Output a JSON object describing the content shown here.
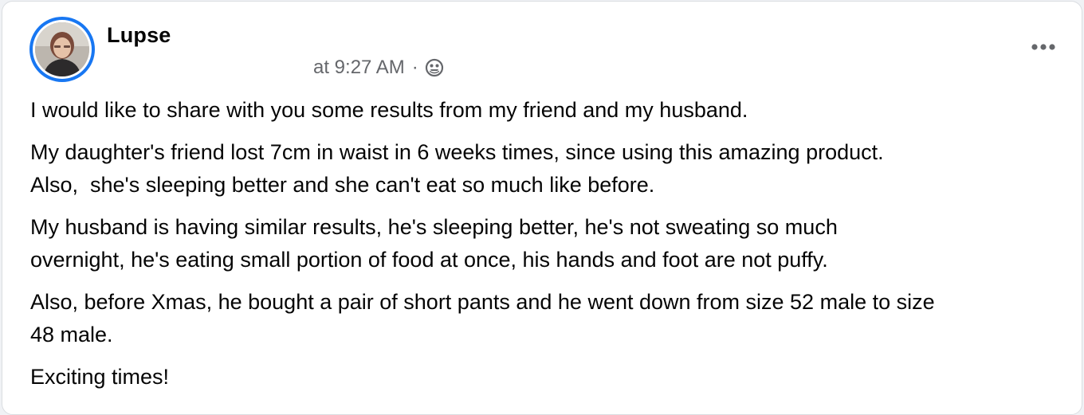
{
  "post": {
    "author": "Lupse",
    "timestamp": "at 9:27 AM",
    "separator": "·",
    "audience_icon": "friends-except-icon",
    "more_icon": "more-options-icon",
    "paragraphs": [
      "I would like to share with you some results from my friend and my husband.",
      "My daughter's friend lost 7cm in waist in 6 weeks times, since using this amazing product.\nAlso,  she's sleeping better and she can't eat so much like before.",
      "My husband is having similar results, he's sleeping better, he's not sweating so much\novernight, he's eating small portion of food at once, his hands and foot are not puffy.",
      "Also, before Xmas, he bought a pair of short pants and he went down from size 52 male to size\n48 male.",
      "Exciting times!"
    ]
  },
  "colors": {
    "ring": "#1877f2",
    "text": "#050505",
    "secondary_text": "#65676b"
  }
}
